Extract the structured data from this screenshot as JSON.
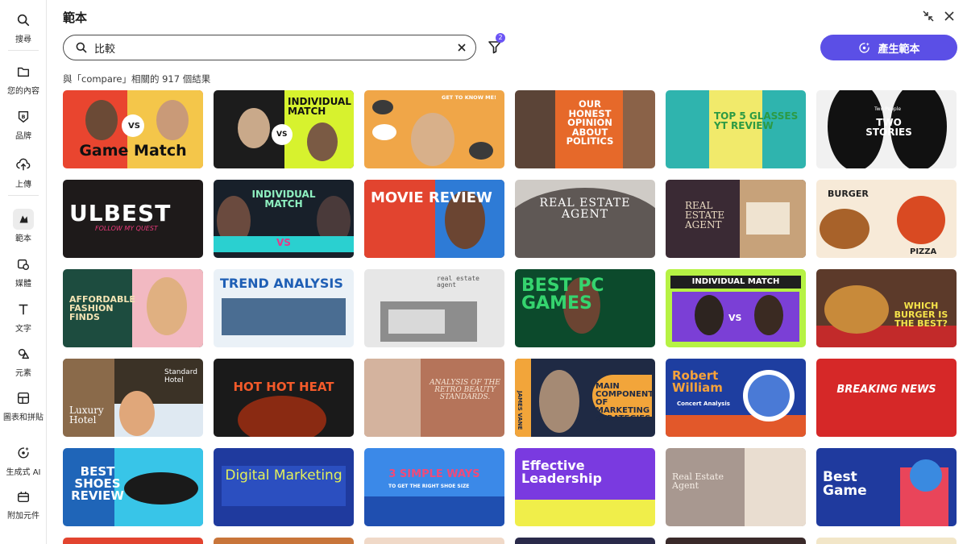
{
  "sidebar": {
    "items": [
      {
        "label": "搜尋",
        "icon": "search-icon"
      },
      {
        "label": "您的內容",
        "icon": "folder-icon"
      },
      {
        "label": "品牌",
        "icon": "brand-icon"
      },
      {
        "label": "上傳",
        "icon": "upload-icon"
      },
      {
        "label": "範本",
        "icon": "templates-icon"
      },
      {
        "label": "媒體",
        "icon": "media-icon"
      },
      {
        "label": "文字",
        "icon": "text-icon"
      },
      {
        "label": "元素",
        "icon": "elements-icon"
      },
      {
        "label": "圖表和拼貼",
        "icon": "charts-icon"
      },
      {
        "label": "生成式 AI",
        "icon": "ai-icon"
      },
      {
        "label": "附加元件",
        "icon": "addons-icon"
      }
    ]
  },
  "panel": {
    "title": "範本"
  },
  "search": {
    "value": "比較",
    "placeholder": ""
  },
  "filter": {
    "badge": "2"
  },
  "generate_button": "產生範本",
  "results": {
    "summary": "與「compare」相關的 917 個結果"
  },
  "templates": [
    {
      "title": "Game Match",
      "sub": "VS"
    },
    {
      "title": "INDIVIDUAL MATCH",
      "sub": "VS"
    },
    {
      "title": "GET TO KNOW ME!",
      "sub": ""
    },
    {
      "title": "OUR HONEST OPINION ABOUT POLITICS",
      "sub": ""
    },
    {
      "title": "TOP 5 GLASSES YT REVIEW",
      "sub": ""
    },
    {
      "title": "TWO STORIES",
      "sub": "Two People"
    },
    {
      "title": "ULBEST",
      "sub": "FOLLOW MY QUEST"
    },
    {
      "title": "INDIVIDUAL MATCH",
      "sub": "VS"
    },
    {
      "title": "MOVIE REVIEW",
      "sub": ""
    },
    {
      "title": "REAL ESTATE AGENT",
      "sub": ""
    },
    {
      "title": "REAL ESTATE AGENT",
      "sub": ""
    },
    {
      "title": "BURGER",
      "sub": "PIZZA"
    },
    {
      "title": "AFFORDABLE FASHION FINDS",
      "sub": ""
    },
    {
      "title": "TREND ANALYSIS",
      "sub": ""
    },
    {
      "title": "real estate agent",
      "sub": ""
    },
    {
      "title": "BEST PC GAMES",
      "sub": ""
    },
    {
      "title": "INDIVIDUAL MATCH",
      "sub": "VS"
    },
    {
      "title": "WHICH BURGER IS THE BEST?",
      "sub": ""
    },
    {
      "title": "Luxury Hotel",
      "sub": "Standard Hotel"
    },
    {
      "title": "HOT HOT HEAT",
      "sub": ""
    },
    {
      "title": "ANALYSIS OF THE RETRO BEAUTY STANDARDS.",
      "sub": ""
    },
    {
      "title": "MAIN COMPONENTS OF MARKETING STRATEGIES",
      "sub": "JAMES VANE"
    },
    {
      "title": "Robert William",
      "sub": "Concert Analysis"
    },
    {
      "title": "BREAKING NEWS",
      "sub": ""
    },
    {
      "title": "BEST SHOES REVIEW",
      "sub": ""
    },
    {
      "title": "Digital Marketing",
      "sub": ""
    },
    {
      "title": "3 SIMPLE WAYS",
      "sub": "TO GET THE RIGHT SHOE SIZE"
    },
    {
      "title": "Effective Leadership",
      "sub": ""
    },
    {
      "title": "Real Estate Agent",
      "sub": ""
    },
    {
      "title": "Best Game",
      "sub": ""
    }
  ]
}
